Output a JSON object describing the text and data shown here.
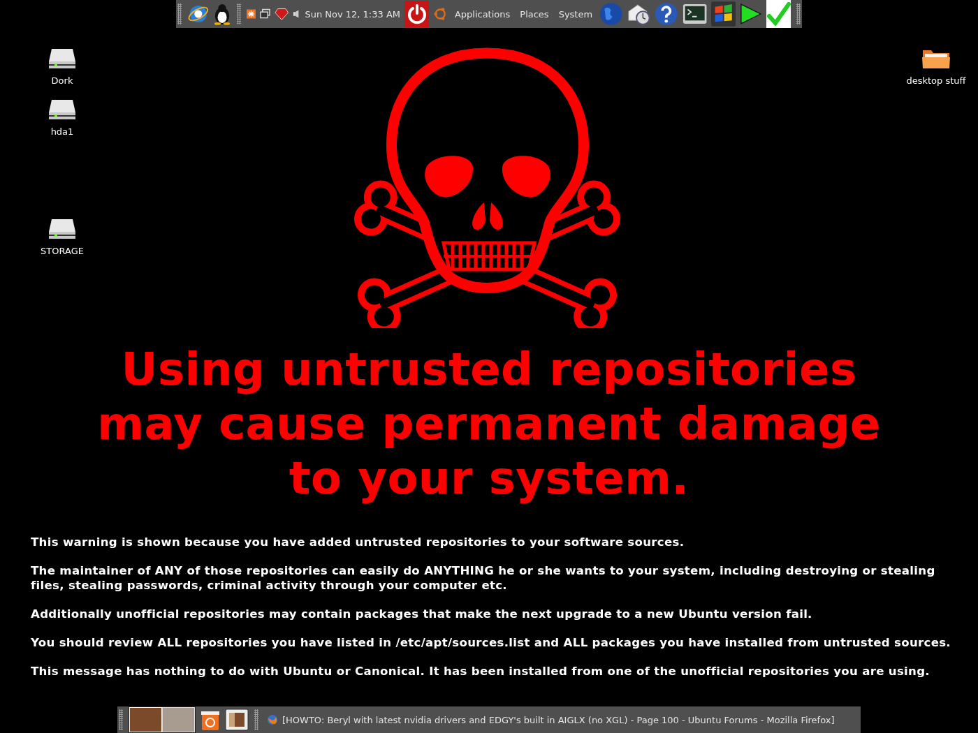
{
  "top_panel": {
    "clock": "Sun Nov 12,  1:33 AM",
    "menus": [
      "Applications",
      "Places",
      "System"
    ]
  },
  "desktop": {
    "left_icons": [
      {
        "label": "Dork",
        "kind": "drive"
      },
      {
        "label": "hda1",
        "kind": "drive"
      },
      {
        "label": "STORAGE",
        "kind": "drive"
      }
    ],
    "right_icons": [
      {
        "label": "desktop stuff",
        "kind": "folder"
      }
    ]
  },
  "warning": {
    "headline": [
      "Using untrusted repositories",
      "may cause permanent damage",
      "to your system."
    ],
    "paragraphs": [
      "This warning is shown because you have added untrusted repositories to your software sources.",
      "The maintainer of ANY of those repositories can easily do ANYTHING he or she wants to your system, including destroying or stealing files, stealing passwords, criminal activity through your computer etc.",
      "Additionally unofficial repositories may contain packages that make the next upgrade to a new Ubuntu version fail.",
      "You should review ALL repositories you have listed in /etc/apt/sources.list and ALL packages you have installed from untrusted sources.",
      "This message has nothing to do with Ubuntu or Canonical. It has been installed from one of the unofficial repositories you are using."
    ]
  },
  "bottom_panel": {
    "workspaces": [
      {
        "selected": true
      },
      {
        "selected": false
      }
    ],
    "tasks": [
      {
        "title": "[HOWTO: Beryl with latest nvidia drivers and EDGY's built in AIGLX (no XGL) - Page 100 - Ubuntu Forums - Mozilla Firefox]"
      }
    ]
  }
}
